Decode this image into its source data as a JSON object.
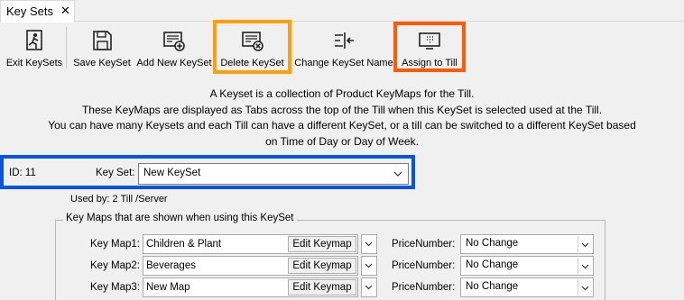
{
  "tab": {
    "label": "Key Sets",
    "close": "✕"
  },
  "toolbar": {
    "exit": "Exit KeySets",
    "save": "Save KeySet",
    "add": "Add New KeySet",
    "delete": "Delete KeySet",
    "change": "Change KeySet Name",
    "assign": "Assign to Till"
  },
  "description": [
    "A Keyset is a collection of Product KeyMaps for the Till.",
    "These KeyMaps are displayed as Tabs across the top of the Till when this KeySet is selected used at the Till.",
    "You can have many Keysets and each Till can have a different KeySet, or a till can be switched to a different KeySet based",
    "on Time of Day or Day of Week."
  ],
  "keyset": {
    "id_label": "ID: 11",
    "label": "Key Set:",
    "value": "New KeySet",
    "used_by": "Used by: 2 Till /Server"
  },
  "group": {
    "title": "Key Maps that are shown when using this KeySet",
    "rows": [
      {
        "label": "Key Map1:",
        "value": "Children & Plant",
        "edit": "Edit Keymap",
        "price_label": "PriceNumber:",
        "price": "No Change"
      },
      {
        "label": "Key Map2:",
        "value": "Beverages",
        "edit": "Edit Keymap",
        "price_label": "PriceNumber:",
        "price": "No Change"
      },
      {
        "label": "Key Map3:",
        "value": "New Map",
        "edit": "Edit Keymap",
        "price_label": "PriceNumber:",
        "price": "No Change"
      }
    ]
  },
  "colors": {
    "highlight_orange": "#ff9f0a",
    "highlight_red_orange": "#ff5a0a",
    "highlight_blue": "#0a55e0"
  }
}
